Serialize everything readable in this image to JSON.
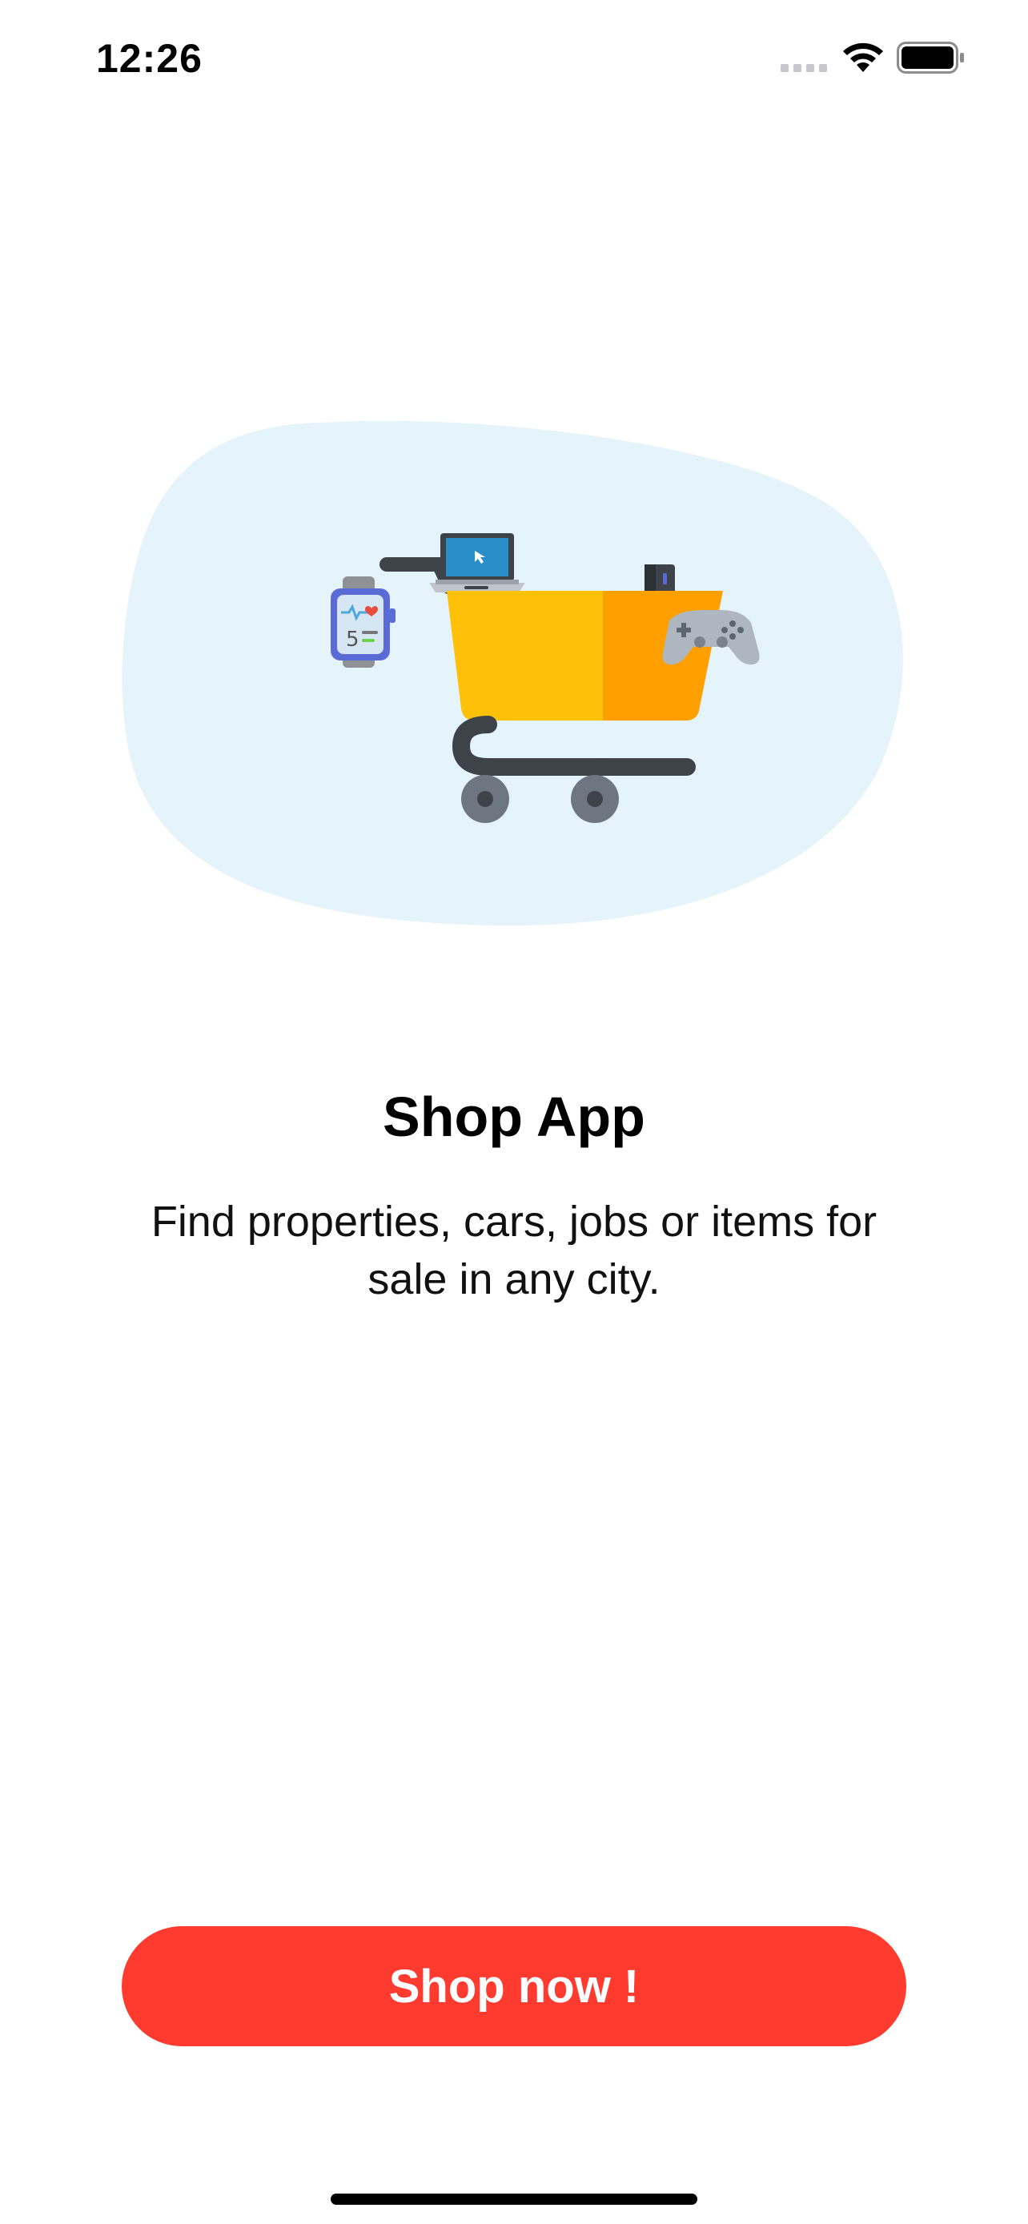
{
  "status_bar": {
    "time": "12:26",
    "icons": [
      "cellular-signal-icon",
      "wifi-icon",
      "battery-icon"
    ]
  },
  "hero": {
    "illustration": "shopping-cart-with-electronics",
    "blob_color": "#E5F4FB",
    "items": [
      "smartwatch",
      "laptop",
      "game-console",
      "gamepad"
    ]
  },
  "onboarding": {
    "title": "Shop App",
    "subtitle": "Find properties, cars, jobs or items for sale in any city."
  },
  "cta": {
    "label": "Shop now !",
    "color": "#FF3B30"
  }
}
